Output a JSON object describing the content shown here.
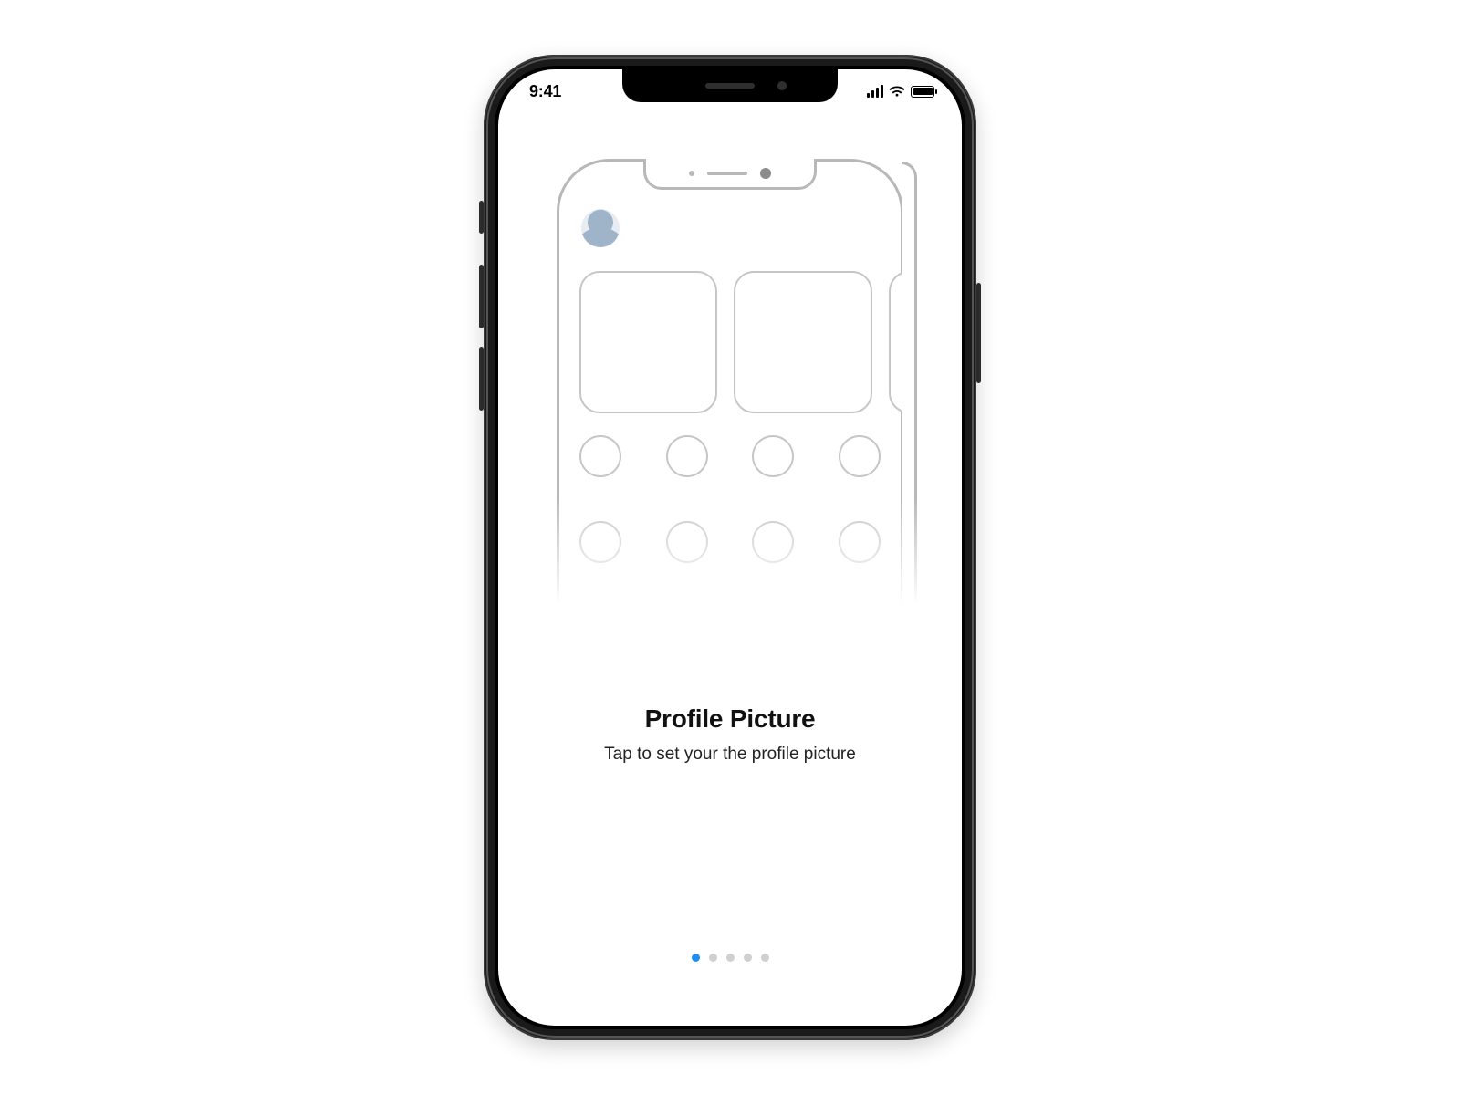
{
  "status_bar": {
    "time": "9:41"
  },
  "onboarding": {
    "title": "Profile Picture",
    "subtitle": "Tap to set your the profile picture",
    "page_count": 5,
    "active_page_index": 0
  },
  "colors": {
    "accent": "#1f8ef1",
    "outline": "#b8b8b8"
  }
}
